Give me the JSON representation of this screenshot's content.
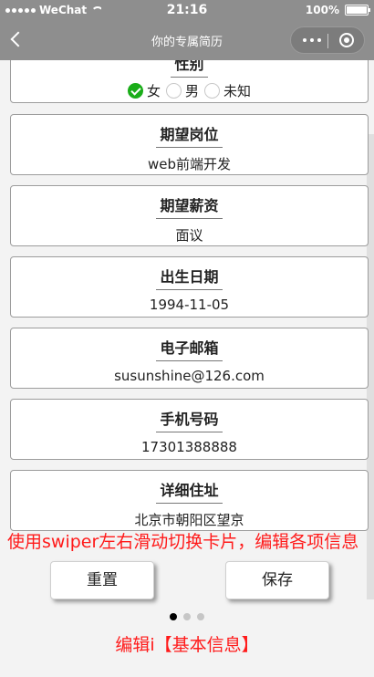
{
  "status_bar": {
    "carrier": "WeChat",
    "time": "21:16",
    "battery": "100%"
  },
  "nav": {
    "title": "你的专属简历"
  },
  "form": {
    "gender": {
      "label": "性别",
      "options": [
        "女",
        "男",
        "未知"
      ],
      "selected": "女"
    },
    "fields": [
      {
        "label": "期望岗位",
        "value": "web前端开发"
      },
      {
        "label": "期望薪资",
        "value": "面议"
      },
      {
        "label": "出生日期",
        "value": "1994-11-05"
      },
      {
        "label": "电子邮箱",
        "value": "susunshine@126.com"
      },
      {
        "label": "手机号码",
        "value": "17301388888"
      },
      {
        "label": "详细住址",
        "value": "北京市朝阳区望京"
      }
    ]
  },
  "note": "使用swiper左右滑动切换卡片，编辑各项信息",
  "buttons": {
    "reset_label": "重置",
    "save_label": "保存"
  },
  "pagination": {
    "total": 3,
    "active": 1
  },
  "caption": "编辑i【基本信息】",
  "colors": {
    "nav_bg": "#8e8e8e",
    "accent_green": "#1aad19",
    "note_red": "#ff1a1a"
  }
}
